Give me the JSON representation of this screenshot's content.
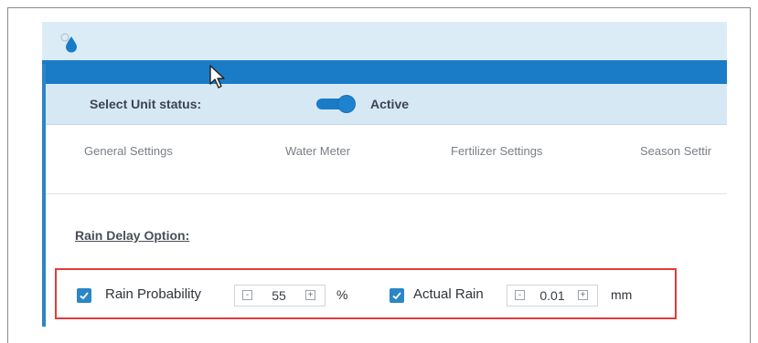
{
  "status": {
    "label": "Select Unit status:",
    "toggle_state": "Active",
    "toggle_on": true
  },
  "tabs": [
    {
      "label": "General Settings"
    },
    {
      "label": "Water Meter"
    },
    {
      "label": "Fertilizer Settings"
    },
    {
      "label": "Season Settir"
    }
  ],
  "rain_delay": {
    "title": "Rain Delay Option:",
    "rain_probability": {
      "label": "Rain Probability",
      "checked": true,
      "value": "55",
      "unit": "%"
    },
    "actual_rain": {
      "label": "Actual Rain",
      "checked": true,
      "value": "0.01",
      "unit": "mm"
    }
  },
  "stepper": {
    "decrement_symbol": "-",
    "increment_symbol": "+"
  },
  "colors": {
    "accent": "#1a7cc6",
    "header_bg": "#dcecf7",
    "highlight": "#e53a3a"
  },
  "icons": [
    "water-drop-icon",
    "checkbox-checked-icon",
    "mouse-cursor-icon"
  ]
}
